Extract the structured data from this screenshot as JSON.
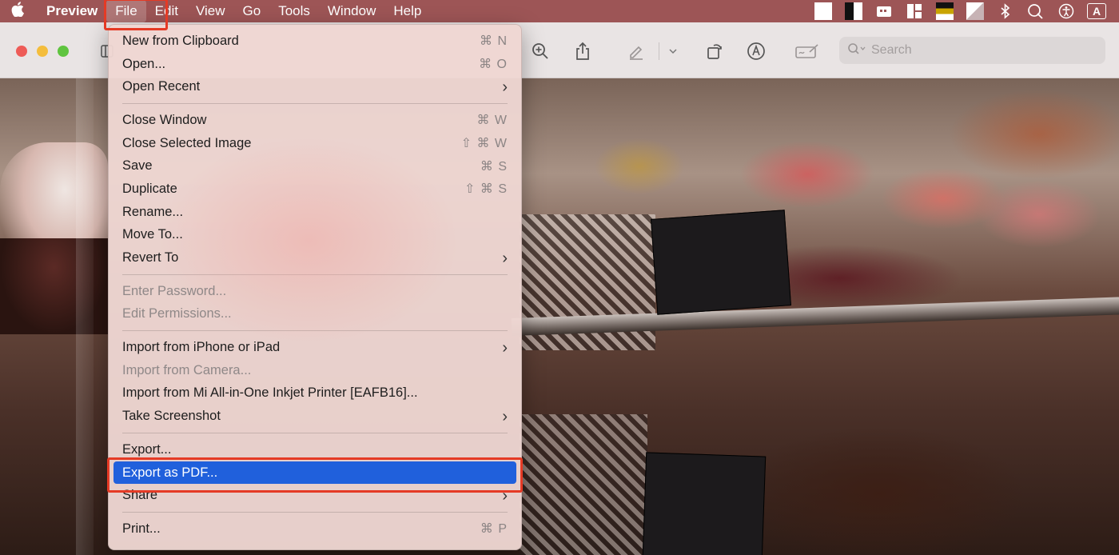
{
  "menubar": {
    "app_name": "Preview",
    "items": [
      "File",
      "Edit",
      "View",
      "Go",
      "Tools",
      "Window",
      "Help"
    ]
  },
  "toolbar": {
    "search_placeholder": "Search"
  },
  "file_menu": {
    "new_from_clipboard": {
      "label": "New from Clipboard",
      "shortcut": "⌘ N"
    },
    "open": {
      "label": "Open...",
      "shortcut": "⌘ O"
    },
    "open_recent": {
      "label": "Open Recent"
    },
    "close_window": {
      "label": "Close Window",
      "shortcut": "⌘ W"
    },
    "close_selected_image": {
      "label": "Close Selected Image",
      "shortcut": "⇧ ⌘ W"
    },
    "save": {
      "label": "Save",
      "shortcut": "⌘ S"
    },
    "duplicate": {
      "label": "Duplicate",
      "shortcut": "⇧ ⌘ S"
    },
    "rename": {
      "label": "Rename..."
    },
    "move_to": {
      "label": "Move To..."
    },
    "revert_to": {
      "label": "Revert To"
    },
    "enter_password": {
      "label": "Enter Password..."
    },
    "edit_permissions": {
      "label": "Edit Permissions..."
    },
    "import_iphone": {
      "label": "Import from iPhone or iPad"
    },
    "import_camera": {
      "label": "Import from Camera..."
    },
    "import_printer": {
      "label": "Import from Mi All-in-One Inkjet Printer [EAFB16]..."
    },
    "take_screenshot": {
      "label": "Take Screenshot"
    },
    "export": {
      "label": "Export..."
    },
    "export_pdf": {
      "label": "Export as PDF..."
    },
    "share": {
      "label": "Share"
    },
    "print": {
      "label": "Print...",
      "shortcut": "⌘ P"
    }
  },
  "colors": {
    "menubar_bg": "#9d5556",
    "highlight_red": "#e53a25",
    "selection_blue": "#2060dc"
  }
}
